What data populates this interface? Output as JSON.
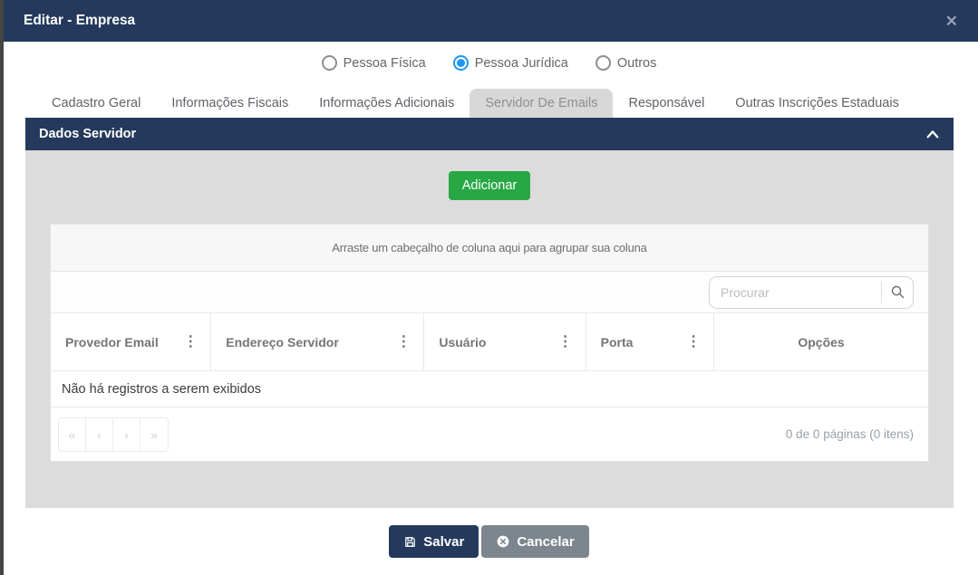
{
  "modal": {
    "title": "Editar - Empresa",
    "close_icon": "✕"
  },
  "person_type": {
    "options": [
      {
        "label": "Pessoa Física",
        "selected": false
      },
      {
        "label": "Pessoa Jurídica",
        "selected": true
      },
      {
        "label": "Outros",
        "selected": false
      }
    ]
  },
  "tabs": {
    "items": [
      {
        "label": "Cadastro Geral",
        "active": false
      },
      {
        "label": "Informações Fiscais",
        "active": false
      },
      {
        "label": "Informações Adicionais",
        "active": false
      },
      {
        "label": "Servidor De Emails",
        "active": true
      },
      {
        "label": "Responsável",
        "active": false
      },
      {
        "label": "Outras Inscrições Estaduais",
        "active": false
      }
    ]
  },
  "section": {
    "title": "Dados Servidor"
  },
  "toolbar": {
    "add_label": "Adicionar"
  },
  "grid": {
    "group_hint": "Arraste um cabeçalho de coluna aqui para agrupar sua coluna",
    "search_placeholder": "Procurar",
    "column_menu_glyph": "⋮",
    "columns": [
      {
        "label": "Provedor Email",
        "has_menu": true
      },
      {
        "label": "Endereço Servidor",
        "has_menu": true
      },
      {
        "label": "Usuário",
        "has_menu": true
      },
      {
        "label": "Porta",
        "has_menu": true
      },
      {
        "label": "Opções",
        "has_menu": false
      }
    ],
    "empty_message": "Não há registros a serem exibidos",
    "pager": {
      "first_glyph": "«",
      "prev_glyph": "‹",
      "next_glyph": "›",
      "last_glyph": "»",
      "info": "0 de 0 páginas (0 itens)"
    }
  },
  "footer": {
    "save_label": "Salvar",
    "cancel_label": "Cancelar"
  },
  "colors": {
    "navy": "#24395b",
    "green": "#28a745",
    "radio_blue": "#2196f3",
    "cancel_gray": "#7d858e",
    "panel_gray": "#dcdcdc"
  }
}
